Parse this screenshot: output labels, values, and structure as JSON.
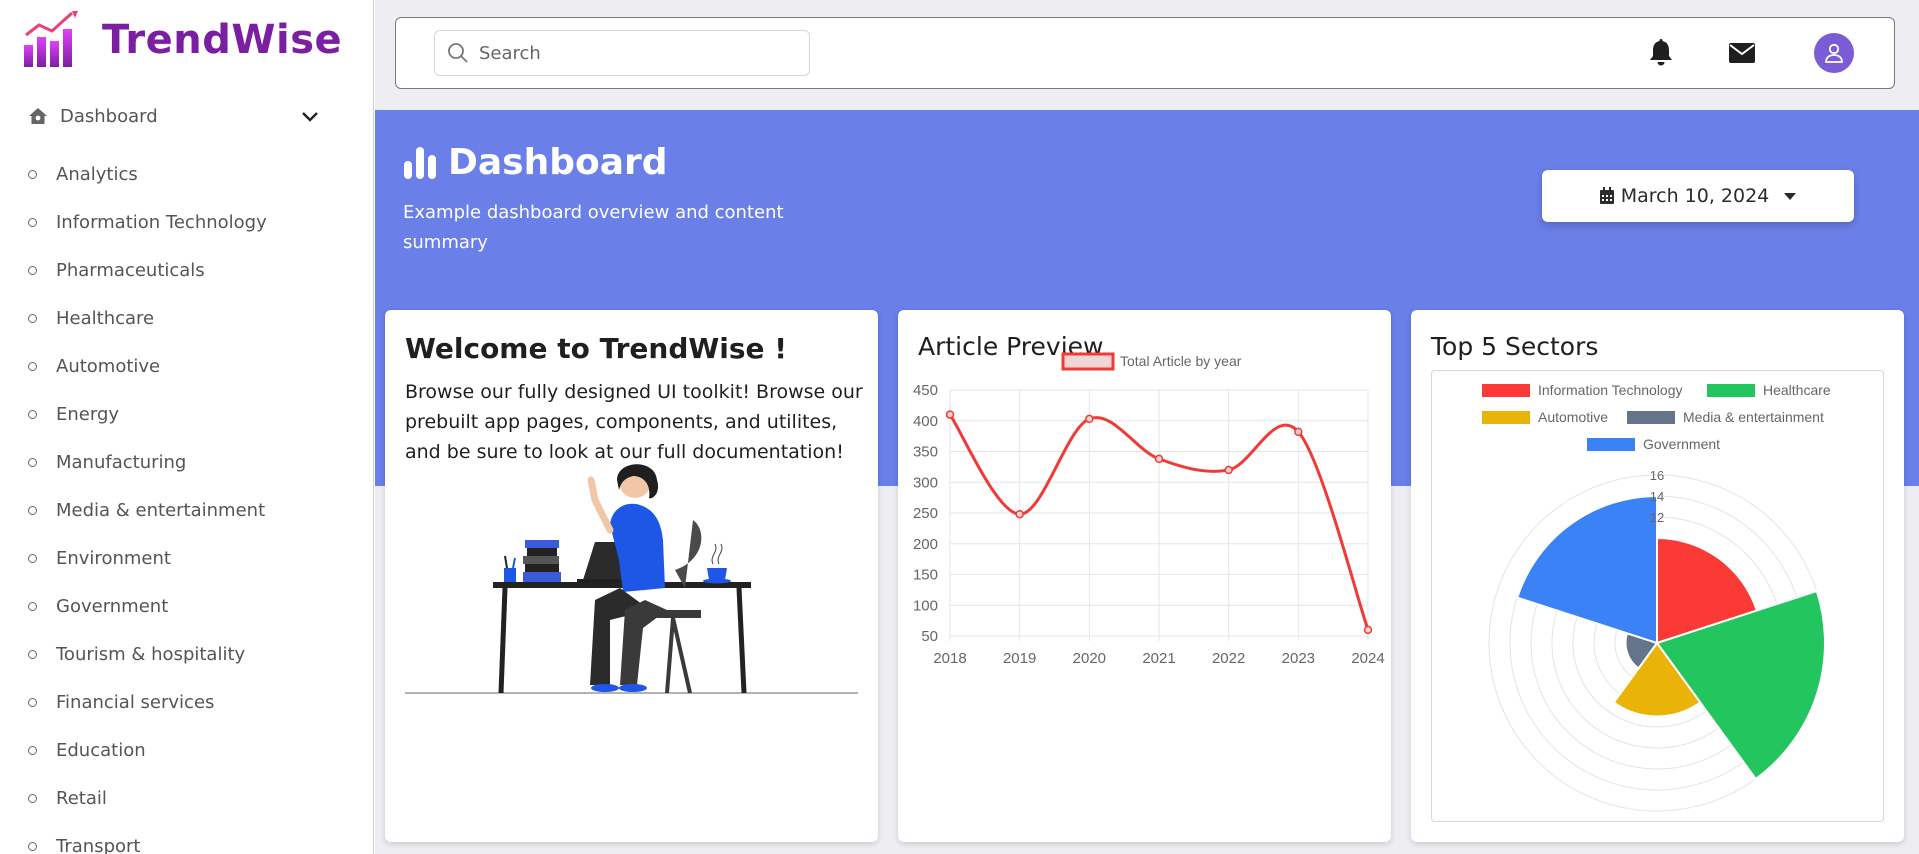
{
  "brand": {
    "name": "TrendWise"
  },
  "sidebar": {
    "dashboard_label": "Dashboard",
    "items": [
      {
        "label": "Analytics"
      },
      {
        "label": "Information Technology"
      },
      {
        "label": "Pharmaceuticals"
      },
      {
        "label": "Healthcare"
      },
      {
        "label": "Automotive"
      },
      {
        "label": "Energy"
      },
      {
        "label": "Manufacturing"
      },
      {
        "label": "Media & entertainment"
      },
      {
        "label": "Environment"
      },
      {
        "label": "Government"
      },
      {
        "label": "Tourism & hospitality"
      },
      {
        "label": "Financial services"
      },
      {
        "label": "Education"
      },
      {
        "label": "Retail"
      },
      {
        "label": "Transport"
      }
    ]
  },
  "topbar": {
    "search_placeholder": "Search",
    "icons": [
      "search-icon",
      "bell-icon",
      "mail-icon",
      "user-icon"
    ]
  },
  "header": {
    "title": "Dashboard",
    "subtitle": "Example dashboard overview and content summary",
    "date": "March 10, 2024"
  },
  "welcome": {
    "title": "Welcome to TrendWise !",
    "body": "Browse our fully designed UI toolkit! Browse our prebuilt app pages, components, and utilites, and be sure to look at our full documentation!"
  },
  "article_card": {
    "title": "Article Preview"
  },
  "sectors_card": {
    "title": "Top 5 Sectors"
  },
  "colors": {
    "brand": "#7b1fa2",
    "banner": "#6a7fe8",
    "line": "#f03a35",
    "it": "#fb3a35",
    "healthcare": "#22c55e",
    "automotive": "#eab308",
    "media": "#64748b",
    "government": "#3b82f6"
  },
  "chart_data": [
    {
      "type": "line",
      "title": "",
      "x": [
        "2018",
        "2019",
        "2020",
        "2021",
        "2022",
        "2023",
        "2024"
      ],
      "series": [
        {
          "name": "Total Article by year",
          "values": [
            410,
            248,
            403,
            338,
            320,
            382,
            60
          ]
        }
      ],
      "ylim": [
        50,
        450
      ],
      "yticks": [
        50,
        100,
        150,
        200,
        250,
        300,
        350,
        400,
        450
      ],
      "grid": true,
      "legend": "top"
    },
    {
      "type": "polarArea",
      "title": "",
      "categories": [
        "Information Technology",
        "Healthcare",
        "Automotive",
        "Media & entertainment",
        "Government"
      ],
      "values": [
        10,
        16,
        7,
        3,
        14
      ],
      "rlim": [
        0,
        16
      ],
      "rticks": [
        "12",
        "14",
        "16"
      ],
      "legend": "top"
    }
  ]
}
